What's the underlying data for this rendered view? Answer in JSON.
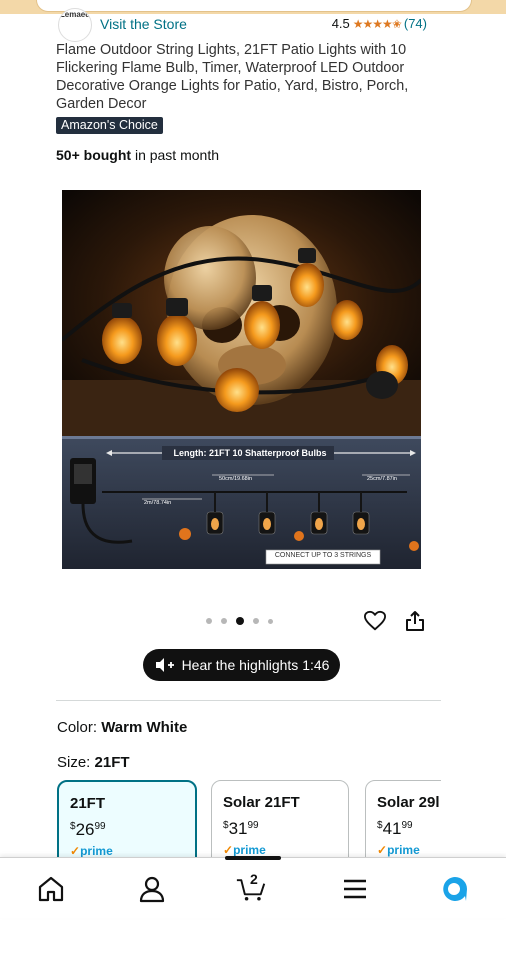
{
  "brand": {
    "logo_text": "Zemaed",
    "visit_store": "Visit the Store",
    "rating": "4.5",
    "stars": "★★★★✬",
    "review_count": "(74)"
  },
  "product": {
    "title": "Flame Outdoor String Lights, 21FT Patio Lights with 10 Flickering Flame Bulb, Timer, Waterproof LED Outdoor Decorative Orange Lights for Patio, Yard, Bistro, Porch, Garden Decor",
    "badge": "Amazon's Choice",
    "bought_bold": "50+ bought",
    "bought_rest": " in past month"
  },
  "image": {
    "length_label": "Length: 21FT 10 Shatterproof Bulbs",
    "spacing_label": "50cm/19.68in",
    "end_label": "25cm/7.87in",
    "lead_label": "2m/78.74in",
    "connect_label": "CONNECT UP TO 3 STRINGS",
    "gallery_count": 5,
    "gallery_active_index": 2
  },
  "highlights": {
    "label": "Hear the highlights 1:46"
  },
  "variations": {
    "color_label": "Color:",
    "color_value": "Warm White",
    "size_label": "Size:",
    "size_value": "21FT",
    "options": [
      {
        "name": "21FT",
        "sym": "$",
        "whole": "26",
        "frac": "99",
        "prime": "prime",
        "prime_check": "✓"
      },
      {
        "name": "Solar 21FT",
        "sym": "$",
        "whole": "31",
        "frac": "99",
        "prime": "prime",
        "prime_check": "✓"
      },
      {
        "name": "Solar 29l",
        "sym": "$",
        "whole": "41",
        "frac": "99",
        "prime": "prime",
        "prime_check": "✓"
      }
    ]
  },
  "nav": {
    "cart_count": "2",
    "icons": [
      "home-icon",
      "account-icon",
      "cart-icon",
      "menu-icon",
      "alexa-icon"
    ]
  },
  "colors": {
    "link": "#007185",
    "star": "#de7921",
    "prime": "#1399d3",
    "badge_bg": "#232f3e",
    "selected_border": "#007185",
    "alexa": "#1aa3e8"
  }
}
